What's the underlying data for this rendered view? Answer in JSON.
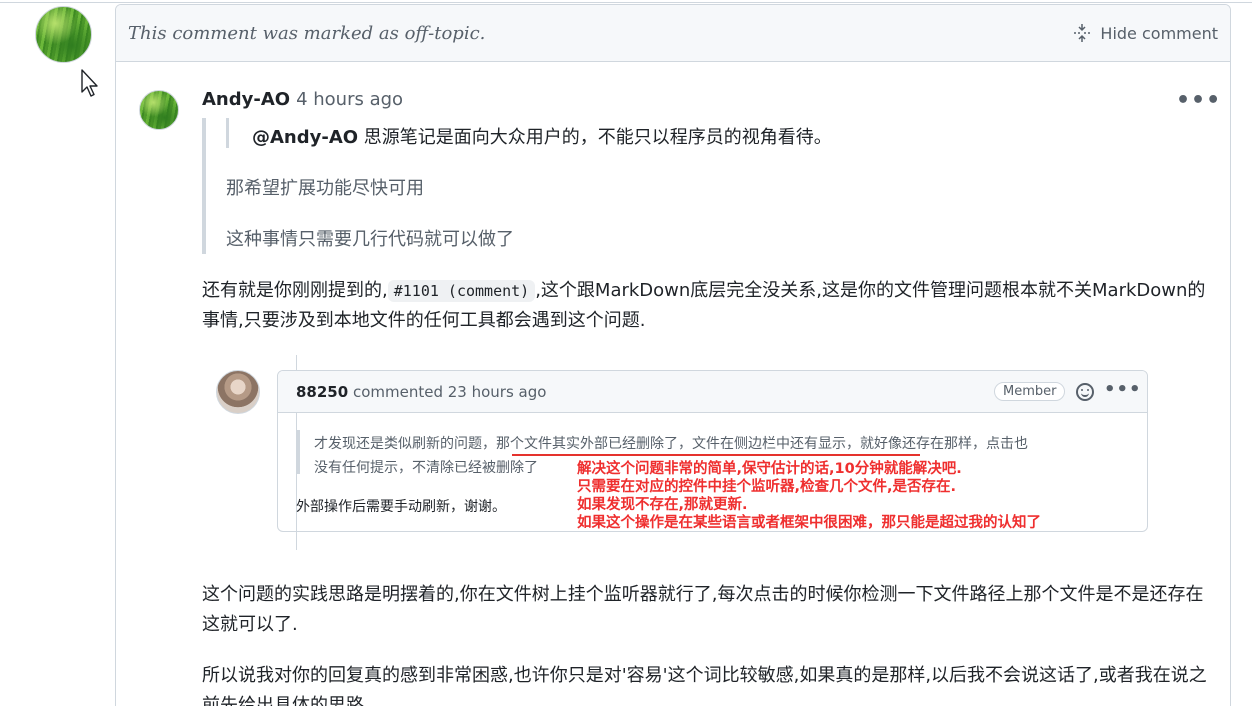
{
  "minimized": {
    "notice": "This comment was marked as off-topic.",
    "hide_label": "Hide comment"
  },
  "comment": {
    "author": "Andy-AO",
    "time": "4 hours ago",
    "menu": "•••",
    "quote": {
      "mention": "@Andy-AO",
      "line1_rest": " 思源笔记是面向大众用户的，不能只以程序员的视角看待。",
      "line2": "那希望扩展功能尽快可用",
      "line3": "这种事情只需要几行代码就可以做了"
    },
    "para1_before": "还有就是你刚刚提到的,",
    "para1_code": "#1101 (comment)",
    "para1_after": ",这个跟MarkDown底层完全没关系,这是你的文件管理问题根本就不关MarkDown的事情,只要涉及到本地文件的任何工具都会遇到这个问题.",
    "para2": "这个问题的实践思路是明摆着的,你在文件树上挂个监听器就行了,每次点击的时候你检测一下文件路径上那个文件是不是还存在这就可以了.",
    "para3": "所以说我对你的回复真的感到非常困惑,也许你只是对'容易'这个词比较敏感,如果真的是那样,以后我不会说这话了,或者我在说之前先给出具体的思路."
  },
  "embed": {
    "user": "88250",
    "action": " commented 23 hours ago",
    "badge": "Member",
    "menu": "•••",
    "quote_line1": "才发现还是类似刷新的问题，那个文件其实外部已经删除了，文件在侧边栏中还有显示，就好像还存在那样，点击也",
    "quote_line2": "没有任何提示，不清除已经被删除了",
    "body": "外部操作后需要手动刷新，谢谢。"
  },
  "annotation": {
    "line1": "解决这个问题非常的简单,保守估计的话,10分钟就能解决吧.",
    "line2": "只需要在对应的控件中挂个监听器,检查几个文件,是否存在.",
    "line3": "如果发现不存在,那就更新.",
    "line4": "如果这个操作是在某些语言或者框架中很困难，那只能是超过我的认知了"
  },
  "colors": {
    "annotation_red": "#ef2f2f",
    "muted_text": "#57606a",
    "border": "#d0d7de"
  }
}
